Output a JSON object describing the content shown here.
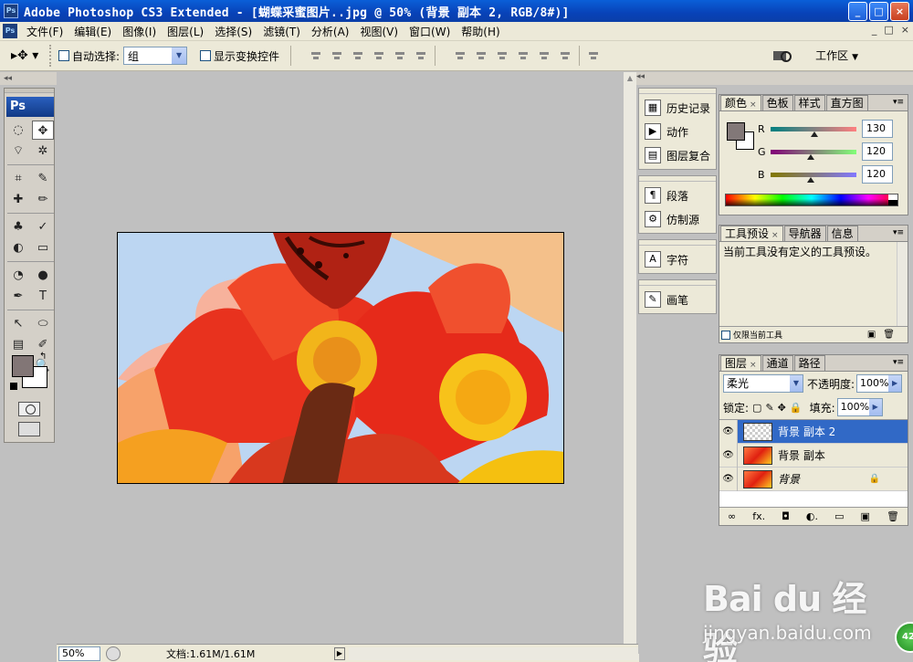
{
  "window": {
    "title": "Adobe Photoshop CS3 Extended - [蝴蝶采蜜图片..jpg @ 50% (背景 副本 2, RGB/8#)]",
    "app_icon_label": "Ps",
    "buttons": [
      "_",
      "□",
      "×"
    ]
  },
  "menu": {
    "items": [
      "文件(F)",
      "编辑(E)",
      "图像(I)",
      "图层(L)",
      "选择(S)",
      "滤镜(T)",
      "分析(A)",
      "视图(V)",
      "窗口(W)",
      "帮助(H)"
    ],
    "doc_controls": [
      "_",
      "□",
      "×"
    ]
  },
  "options": {
    "auto_select_label": "自动选择:",
    "auto_select_value": "组",
    "show_transform_label": "显示变换控件",
    "workspace_label": "工作区"
  },
  "toolbox": {
    "logo": "Ps",
    "tools": [
      "◌",
      "✥",
      "⌔",
      "✲",
      "⌗",
      "✎",
      "✚",
      "✏",
      "♣",
      "✓",
      "◐",
      "▭",
      "◔",
      "●",
      "✒",
      "T",
      "↖",
      "⬭",
      "▤",
      "✐",
      "✋",
      "🔍"
    ],
    "active_tool_index": 1
  },
  "status": {
    "zoom": "50%",
    "doc": "文档:1.61M/1.61M"
  },
  "dock": {
    "groups": [
      [
        {
          "icon": "▦",
          "label": "历史记录"
        },
        {
          "icon": "▶",
          "label": "动作"
        },
        {
          "icon": "▤",
          "label": "图层复合"
        }
      ],
      [
        {
          "icon": "¶",
          "label": "段落"
        },
        {
          "icon": "⚙",
          "label": "仿制源"
        }
      ],
      [
        {
          "icon": "A",
          "label": "字符"
        }
      ],
      [
        {
          "icon": "✎",
          "label": "画笔"
        }
      ]
    ]
  },
  "color_panel": {
    "tabs": [
      "颜色",
      "色板",
      "样式",
      "直方图"
    ],
    "channels": [
      {
        "label": "R",
        "value": "130",
        "from": "#008080",
        "to": "#ff8080"
      },
      {
        "label": "G",
        "value": "120",
        "from": "#820078",
        "to": "#82ff78"
      },
      {
        "label": "B",
        "value": "120",
        "from": "#827800",
        "to": "#8278ff"
      }
    ],
    "foreground": "#827878"
  },
  "tool_panel": {
    "tabs": [
      "工具预设",
      "导航器",
      "信息"
    ],
    "message": "当前工具没有定义的工具预设。",
    "footer_label": "仅限当前工具"
  },
  "layers_panel": {
    "tabs": [
      "图层",
      "通道",
      "路径"
    ],
    "blend_mode": "柔光",
    "opacity_label": "不透明度:",
    "opacity": "100%",
    "lock_label": "锁定:",
    "fill_label": "填充:",
    "fill": "100%",
    "layers": [
      {
        "name": "背景 副本 2",
        "selected": true,
        "thumb": "blank",
        "locked": false
      },
      {
        "name": "背景 副本",
        "selected": false,
        "thumb": "flower",
        "locked": false
      },
      {
        "name": "背景",
        "selected": false,
        "thumb": "flower",
        "locked": true
      }
    ],
    "footer_icons": [
      "∞",
      "fx.",
      "◘",
      "◐.",
      "▭",
      "▣",
      "🗑"
    ]
  },
  "watermark": {
    "logo": "Bai du 经验",
    "url": "jingyan.baidu.com",
    "badge": "42"
  }
}
